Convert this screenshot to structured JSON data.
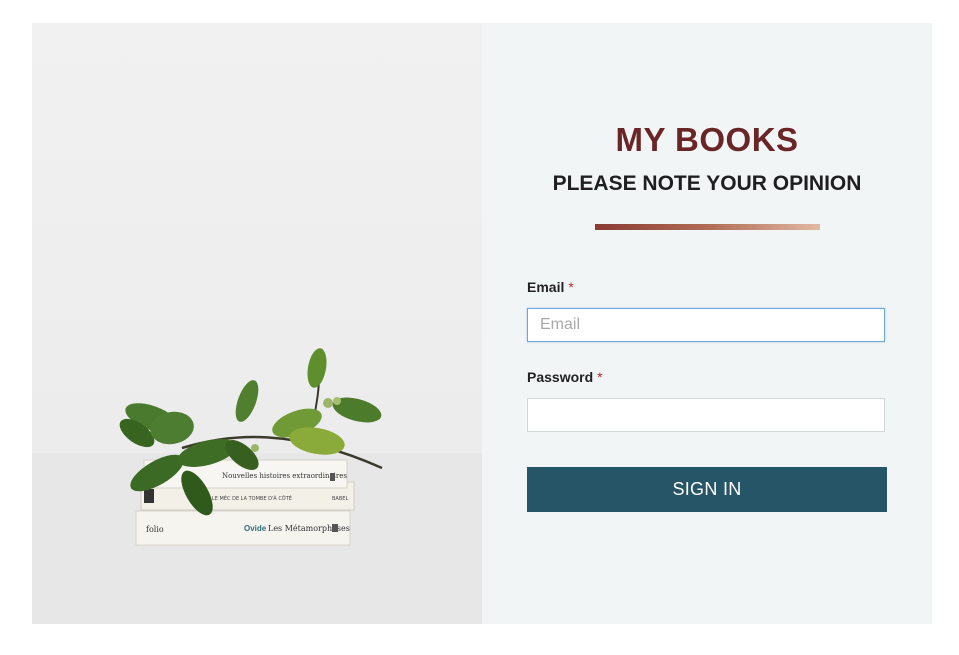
{
  "header": {
    "title": "MY BOOKS",
    "subtitle": "PLEASE NOTE YOUR OPINION"
  },
  "form": {
    "email_label": "Email",
    "email_required": "*",
    "email_placeholder": "Email",
    "email_value": "",
    "password_label": "Password",
    "password_required": "*",
    "password_value": "",
    "submit_label": "SIGN IN"
  },
  "hero": {
    "book_titles": [
      "Nouvelles histoires extraordinaires",
      "Le Méc de la Tombe d'à Côté",
      "Les Métamorphoses"
    ],
    "book_authors": [
      "Ovide"
    ],
    "book_publisher": "folio"
  },
  "colors": {
    "title": "#6a2626",
    "button": "#275568",
    "panel_bg": "#f2f5f6",
    "divider_start": "#8a3b32",
    "divider_end": "#e1b9a3"
  },
  "icons": [
    "plant-image"
  ]
}
